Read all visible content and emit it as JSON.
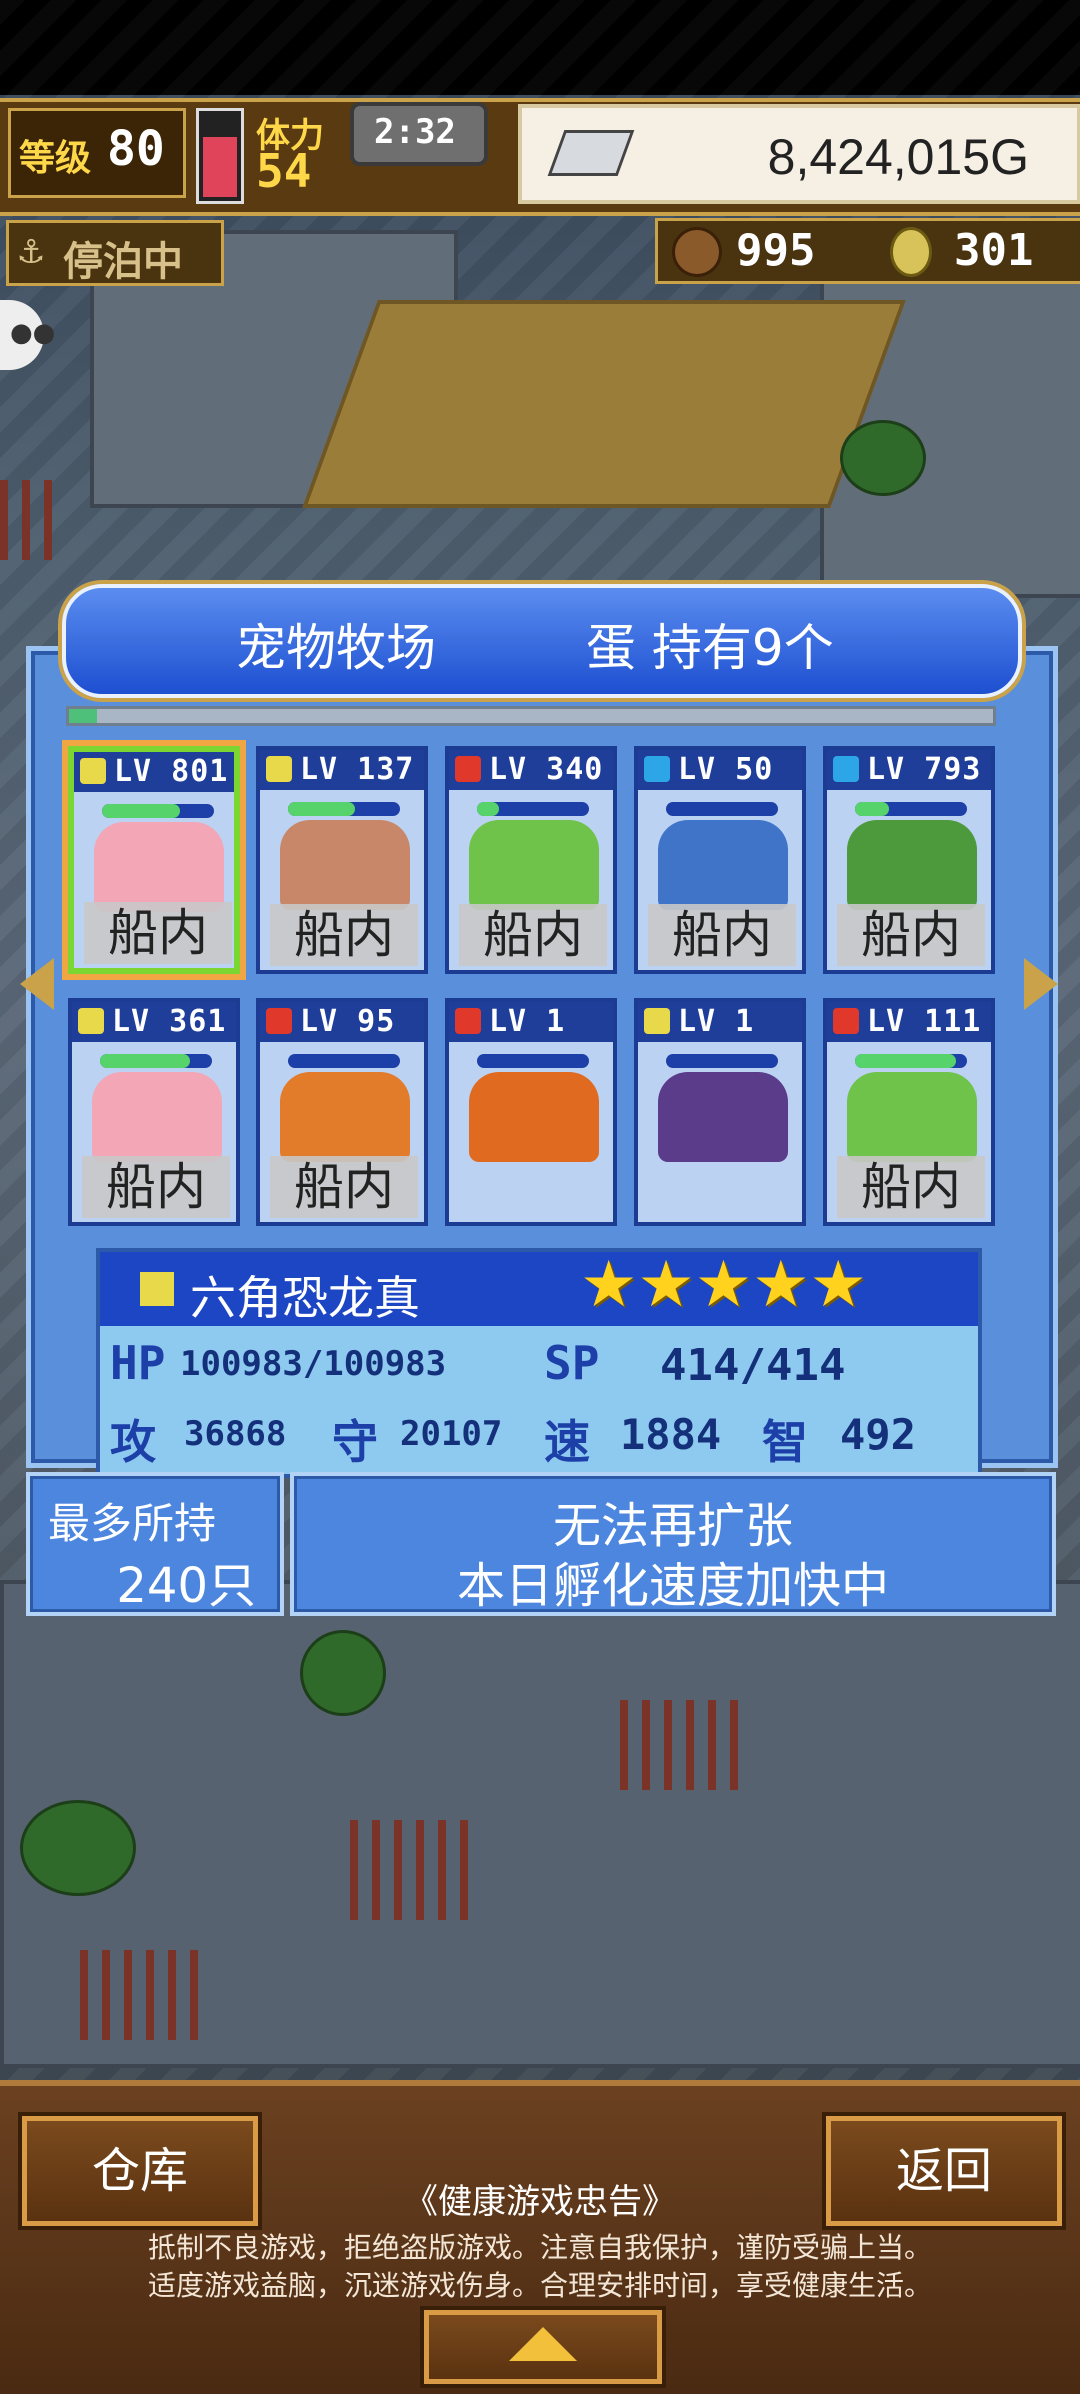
{
  "hud": {
    "level_label": "等级",
    "level_value": "80",
    "stamina_label": "体力",
    "stamina_value": "54",
    "timer": "2:32",
    "gold": "8,424,015G",
    "dock_status": "停泊中",
    "resource_1": "995",
    "resource_2": "301"
  },
  "panel": {
    "title": "宠物牧场",
    "egg_info": "蛋 持有9个",
    "progress": 0.03
  },
  "pets": [
    {
      "level": "LV 801",
      "element": "earth",
      "location": "船内",
      "hp": 0.7,
      "selected": true,
      "color": "#f2a6b6"
    },
    {
      "level": "LV 137",
      "element": "earth",
      "location": "船内",
      "hp": 0.6,
      "selected": false,
      "color": "#c9876a"
    },
    {
      "level": "LV 340",
      "element": "fire",
      "location": "船内",
      "hp": 0.2,
      "selected": false,
      "color": "#6fc24a"
    },
    {
      "level": "LV 50",
      "element": "water",
      "location": "船内",
      "hp": 0.0,
      "selected": false,
      "color": "#3f74c9"
    },
    {
      "level": "LV 793",
      "element": "water",
      "location": "船内",
      "hp": 0.3,
      "selected": false,
      "color": "#4c9a3c"
    },
    {
      "level": "LV 361",
      "element": "earth",
      "location": "船内",
      "hp": 0.8,
      "selected": false,
      "color": "#f2a6b6"
    },
    {
      "level": "LV 95",
      "element": "fire",
      "location": "船内",
      "hp": 0.0,
      "selected": false,
      "color": "#e27b2a"
    },
    {
      "level": "LV 1",
      "element": "fire",
      "location": "",
      "hp": 0.0,
      "selected": false,
      "color": "#e06b20"
    },
    {
      "level": "LV 1",
      "element": "earth",
      "location": "",
      "hp": 0.0,
      "selected": false,
      "color": "#5a3c8a"
    },
    {
      "level": "LV 111",
      "element": "fire",
      "location": "船内",
      "hp": 0.9,
      "selected": false,
      "color": "#6fc24a"
    }
  ],
  "element_colors": {
    "earth": "#e8d94a",
    "fire": "#e0382a",
    "water": "#2da6e8"
  },
  "selected_pet": {
    "name": "六角恐龙真",
    "stars": 5,
    "hp_label": "HP",
    "hp_value": "100983/100983",
    "sp_label": "SP",
    "sp_value": "414/414",
    "atk_label": "攻",
    "atk_value": "36868",
    "def_label": "守",
    "def_value": "20107",
    "spd_label": "速",
    "spd_value": "1884",
    "int_label": "智",
    "int_value": "492"
  },
  "capacity": {
    "label": "最多所持",
    "value": "240只"
  },
  "message": {
    "line1": "无法再扩张",
    "line2": "本日孵化速度加快中"
  },
  "footer": {
    "warehouse_label": "仓库",
    "back_label": "返回",
    "notice_title": "《健康游戏忠告》",
    "notice_line1": "抵制不良游戏，拒绝盗版游戏。注意自我保护，谨防受骗上当。",
    "notice_line2": "适度游戏益脑，沉迷游戏伤身。合理安排时间，享受健康生活。"
  }
}
